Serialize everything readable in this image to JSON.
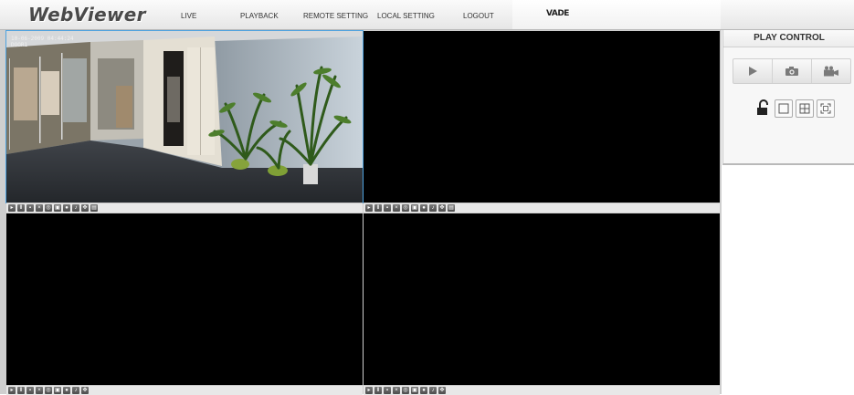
{
  "header": {
    "logo": "WebViewer",
    "nav": {
      "live": "LIVE",
      "playback": "PLAYBACK",
      "remote_setting": "REMOTE SETTING",
      "local_setting": "LOCAL SETTING",
      "logout": "LOGOUT"
    },
    "brand": "VADE"
  },
  "cameras": [
    {
      "timestamp": "10-06-2009 04:44:24",
      "name": "DOOR1",
      "active": true
    },
    {
      "active": false
    },
    {
      "active": false
    },
    {
      "active": false
    }
  ],
  "camera_toolbar_icons": [
    "play-icon",
    "pause-icon",
    "stop-icon",
    "close-icon",
    "zoom-icon",
    "snapshot-icon",
    "record-icon",
    "audio-icon",
    "ptz-icon",
    "lock-icon"
  ],
  "play_control": {
    "title": "PLAY CONTROL",
    "buttons": [
      "play-icon",
      "camera-icon",
      "video-camera-icon"
    ],
    "layout_buttons": [
      "unlock-icon",
      "single-view-icon",
      "quad-view-icon",
      "fullscreen-icon"
    ]
  },
  "colors": {
    "active_border": "#4fa3e0",
    "video_bg": "#000000"
  }
}
